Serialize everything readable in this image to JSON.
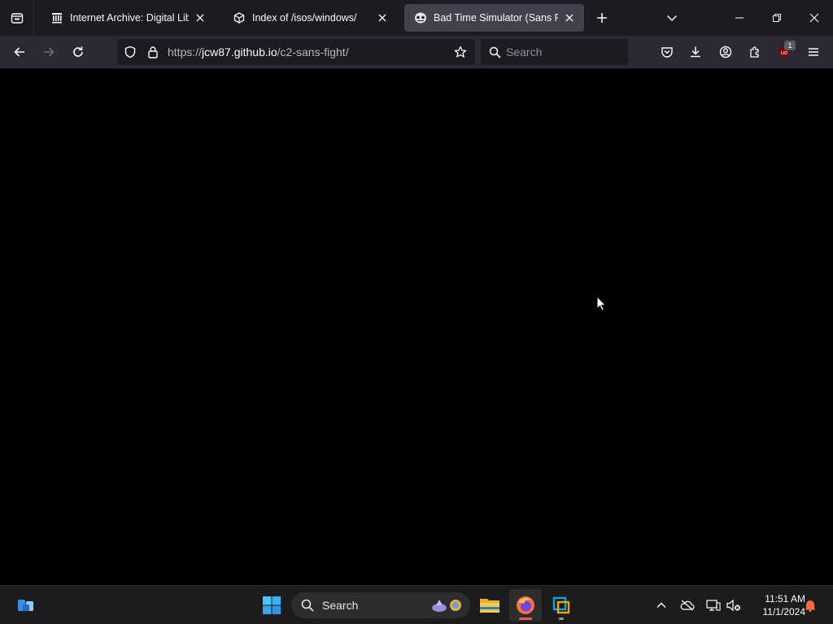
{
  "browser": {
    "tabs": [
      {
        "title": "Internet Archive: Digital Library",
        "favicon": "library-icon",
        "selected": false
      },
      {
        "title": "Index of /isos/windows/",
        "favicon": "page-icon",
        "selected": false
      },
      {
        "title": "Bad Time Simulator (Sans Fight",
        "favicon": "skull-icon",
        "selected": true
      }
    ],
    "url": {
      "scheme": "https://",
      "host": "jcw87.github.io",
      "path": "/c2-sans-fight/"
    },
    "search_placeholder": "Search",
    "extension_badge": "1",
    "colors": {
      "tabstrip": "#1c1b22",
      "toolbar": "#2b2a33",
      "selected_tab": "#42414d",
      "field": "#1c1b22"
    }
  },
  "page": {
    "background": "#000000"
  },
  "taskbar": {
    "search_label": "Search",
    "clock": {
      "time": "11:51 AM",
      "date": "11/1/2024"
    },
    "apps": [
      "file-explorer-icon",
      "firefox-icon",
      "virtualbox-icon"
    ],
    "tray": [
      "chevron-up-icon",
      "onedrive-off-icon",
      "network-icon",
      "volume-muted-icon",
      "notification-bell-icon"
    ]
  }
}
